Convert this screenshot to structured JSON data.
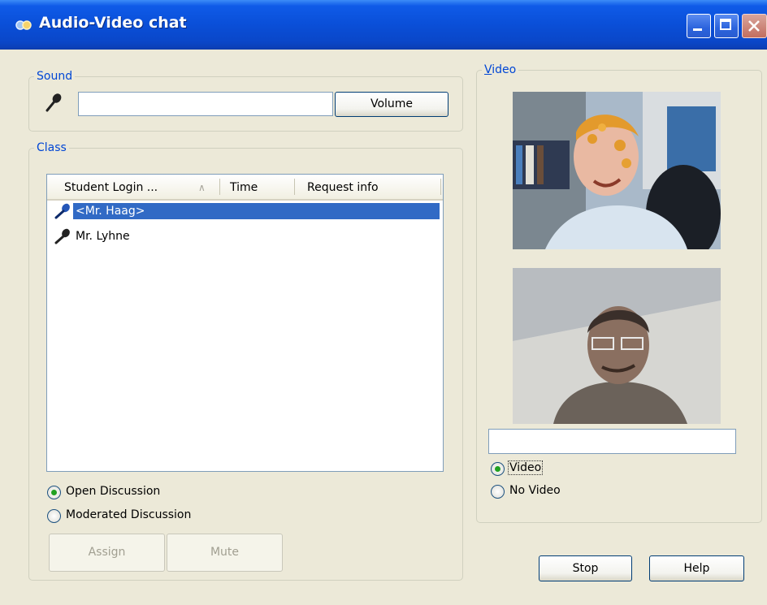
{
  "window": {
    "title": "Audio-Video chat"
  },
  "sound": {
    "group_label": "Sound",
    "level_value": "",
    "volume_button": "Volume"
  },
  "class": {
    "group_label": "Class",
    "columns": [
      "Student Login ...",
      "Time",
      "Request info"
    ],
    "sort_indicator": "∧",
    "rows": [
      {
        "name": "<Mr. Haag>",
        "time": "",
        "request_info": "",
        "selected": true,
        "icon": "microphone-icon"
      },
      {
        "name": "Mr. Lyhne",
        "time": "",
        "request_info": "",
        "selected": false,
        "icon": "microphone-icon"
      }
    ],
    "modes": [
      {
        "label": "Open Discussion",
        "checked": true
      },
      {
        "label": "Moderated Discussion",
        "checked": false
      }
    ],
    "assign_button": "Assign",
    "mute_button": "Mute"
  },
  "video": {
    "group_label": "Video",
    "status_value": "",
    "options": [
      {
        "label": "Video",
        "checked": true
      },
      {
        "label": "No Video",
        "checked": false
      }
    ]
  },
  "footer": {
    "stop_button": "Stop",
    "help_button": "Help"
  },
  "colors": {
    "title_bar": "#0A4FD8",
    "selection": "#316AC5",
    "group_label": "#0046D5",
    "face": "#ECE9D8"
  }
}
